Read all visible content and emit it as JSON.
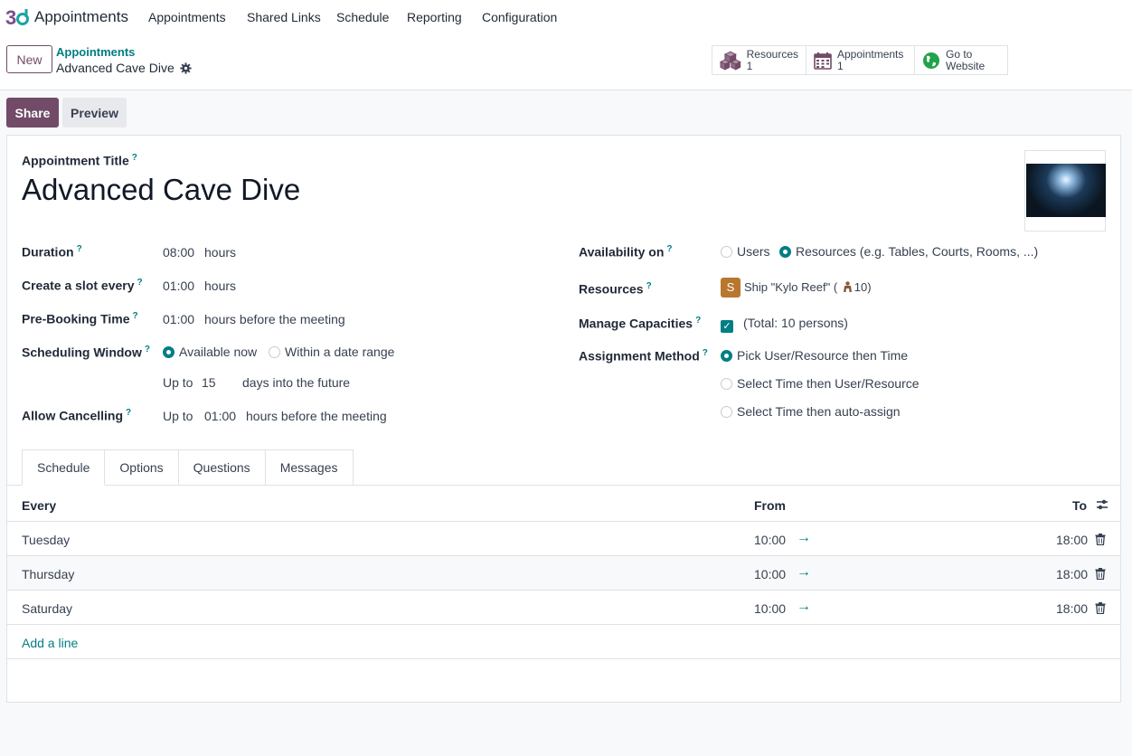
{
  "nav": {
    "app_name": "Appointments",
    "menu": [
      "Appointments",
      "Shared Links",
      "Schedule",
      "Reporting",
      "Configuration"
    ]
  },
  "control": {
    "new_label": "New",
    "breadcrumb_parent": "Appointments",
    "breadcrumb_current": "Advanced Cave Dive",
    "stats": [
      {
        "label": "Resources",
        "value": "1",
        "icon": "cubes-icon"
      },
      {
        "label": "Appointments",
        "value": "1",
        "icon": "calendar-icon"
      },
      {
        "label": "Go to",
        "value": "Website",
        "icon": "globe-icon"
      }
    ]
  },
  "actions": {
    "share": "Share",
    "preview": "Preview"
  },
  "form": {
    "title_label": "Appointment Title",
    "title": "Advanced Cave Dive",
    "help_mark": "?",
    "duration": {
      "label": "Duration",
      "value": "08:00",
      "unit": "hours"
    },
    "slot": {
      "label": "Create a slot every",
      "value": "01:00",
      "unit": "hours"
    },
    "prebook": {
      "label": "Pre-Booking Time",
      "value": "01:00",
      "unit": "hours before the meeting"
    },
    "window": {
      "label": "Scheduling Window",
      "opt1": "Available now",
      "opt2": "Within a date range",
      "upto": "Up to",
      "days": "15",
      "days_suffix": "days into the future"
    },
    "cancel": {
      "label": "Allow Cancelling",
      "upto": "Up to",
      "value": "01:00",
      "suffix": "hours before the meeting"
    },
    "availability": {
      "label": "Availability on",
      "opt1": "Users",
      "opt2": "Resources (e.g. Tables, Courts, Rooms, ...)"
    },
    "resources": {
      "label": "Resources",
      "avatar": "S",
      "name": "Ship \"Kylo Reef\" (",
      "capacity": "10)"
    },
    "capacities": {
      "label": "Manage Capacities",
      "text": "(Total: 10 persons)"
    },
    "assignment": {
      "label": "Assignment Method",
      "opt1": "Pick User/Resource then Time",
      "opt2": "Select Time then User/Resource",
      "opt3": "Select Time then auto-assign"
    }
  },
  "tabs": [
    "Schedule",
    "Options",
    "Questions",
    "Messages"
  ],
  "table": {
    "headers": {
      "every": "Every",
      "from": "From",
      "to": "To"
    },
    "rows": [
      {
        "day": "Tuesday",
        "from": "10:00",
        "to": "18:00"
      },
      {
        "day": "Thursday",
        "from": "10:00",
        "to": "18:00"
      },
      {
        "day": "Saturday",
        "from": "10:00",
        "to": "18:00"
      }
    ],
    "add_line": "Add a line"
  },
  "colors": {
    "primary": "#714b67",
    "accent": "#017e84"
  }
}
